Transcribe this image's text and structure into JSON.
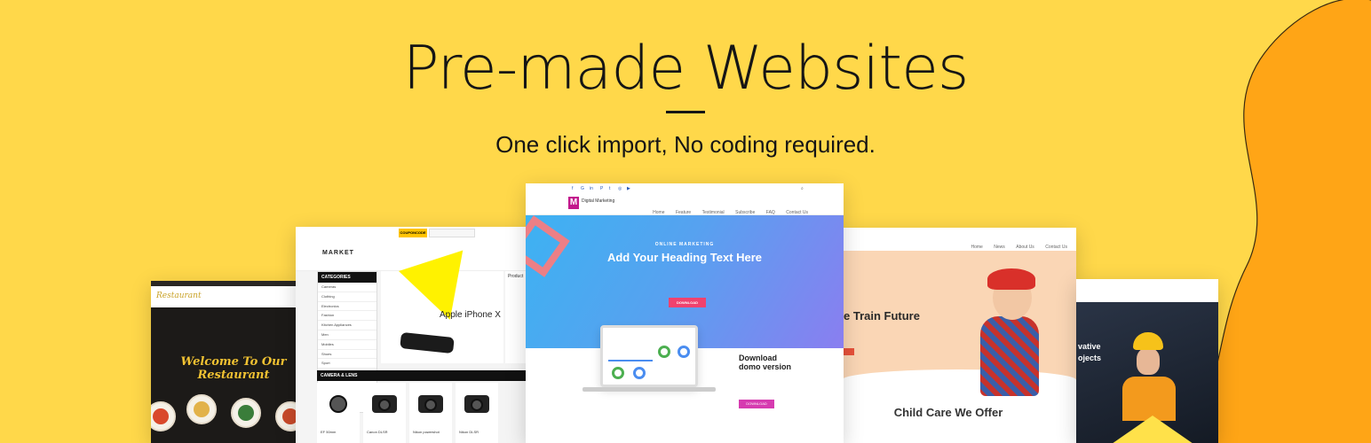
{
  "header": {
    "title": "Pre-made Websites",
    "subtitle": "One click import, No coding required."
  },
  "colors": {
    "background": "#ffd84a",
    "blob": "#ffa516",
    "text": "#151515"
  },
  "restaurant": {
    "logo": "Restaurant",
    "welcome_line1": "Welcome To Our",
    "welcome_line2": "Restaurant"
  },
  "market": {
    "logo": "MARKET",
    "coupon": "COUPONCODE",
    "categories_title": "CATEGORIES",
    "categories": [
      "Cameras",
      "Clothing",
      "Electronics",
      "Fashion",
      "Kitchen Appliances",
      "Men",
      "Mobiles",
      "Shoes",
      "Sport"
    ],
    "banner_title": "Apple iPhone X",
    "products_label": "Product",
    "camera_header": "CAMERA & LENS",
    "cameras": [
      "EF 50mm",
      "Canon DLSR",
      "Nikon powershot",
      "Nikon DLSR"
    ]
  },
  "digital": {
    "brand": "Digital Marketing",
    "nav": [
      "Home",
      "Feature",
      "Testimonial",
      "Subscribe",
      "FAQ",
      "Contact Us"
    ],
    "eyebrow": "ONLINE MARKETING",
    "heading": "Add Your Heading Text Here",
    "button": "DOWNLOAD",
    "download_line1": "Download",
    "download_line2": "domo version",
    "download_button": "DOWNLOAD"
  },
  "child": {
    "nav": [
      "Home",
      "News",
      "About Us",
      "Contact Us"
    ],
    "hero_title": "e Train Future",
    "section_title": "Child Care We Offer"
  },
  "construction": {
    "hero_line1": "vative",
    "hero_line2": "ojects"
  }
}
